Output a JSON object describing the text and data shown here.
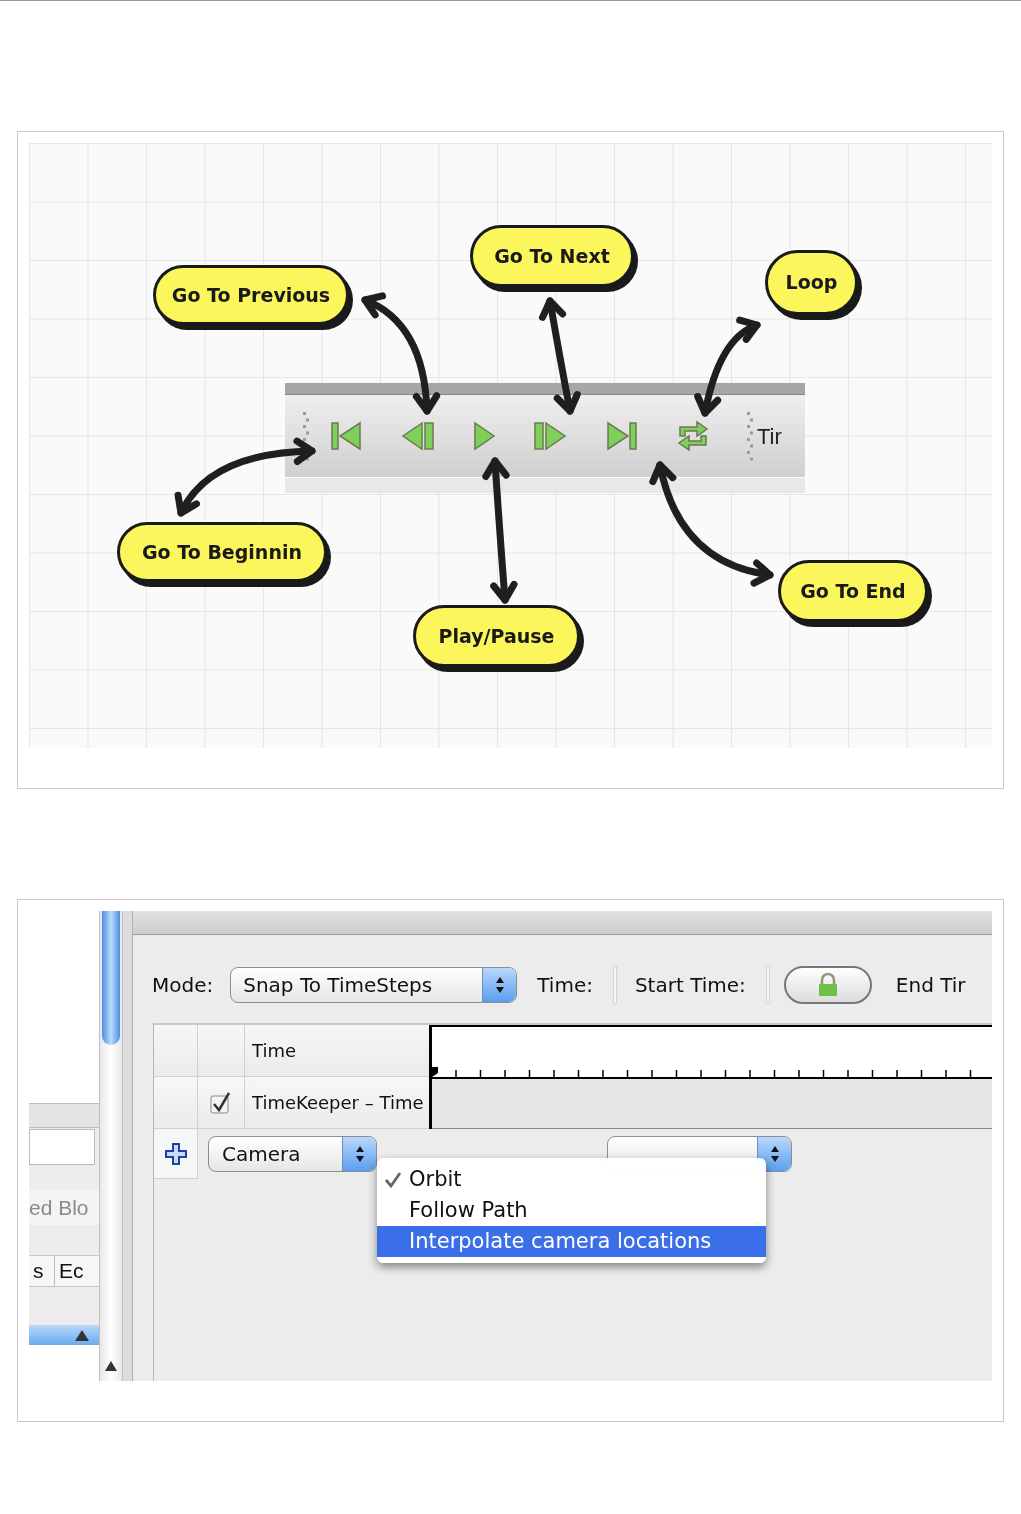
{
  "figure_1": {
    "toolbar": {
      "label": "Tir"
    },
    "callouts": [
      {
        "label": "Go To Previous"
      },
      {
        "label": "Go To Next"
      },
      {
        "label": "Loop"
      },
      {
        "label": "Go To Beginnin"
      },
      {
        "label": "Play/Pause"
      },
      {
        "label": "Go To End"
      }
    ]
  },
  "figure_2": {
    "sidebar": {
      "label": "ed Blo",
      "columns": [
        "s",
        "Ec"
      ]
    },
    "mode_label": "Mode:",
    "mode_select": "Snap To TimeSteps",
    "time_label": "Time:",
    "start_time_label": "Start Time:",
    "end_time_label": "End Tir",
    "tracks": [
      {
        "kind": "header",
        "label": "Time"
      },
      {
        "kind": "track",
        "label": "TimeKeeper – Time",
        "checked": true
      }
    ],
    "camera_select": "Camera",
    "menu": [
      {
        "label": "Orbit",
        "checked": true,
        "highlighted": false
      },
      {
        "label": "Follow Path",
        "checked": false,
        "highlighted": false
      },
      {
        "label": "Interpolate camera locations",
        "checked": false,
        "highlighted": true
      }
    ]
  }
}
